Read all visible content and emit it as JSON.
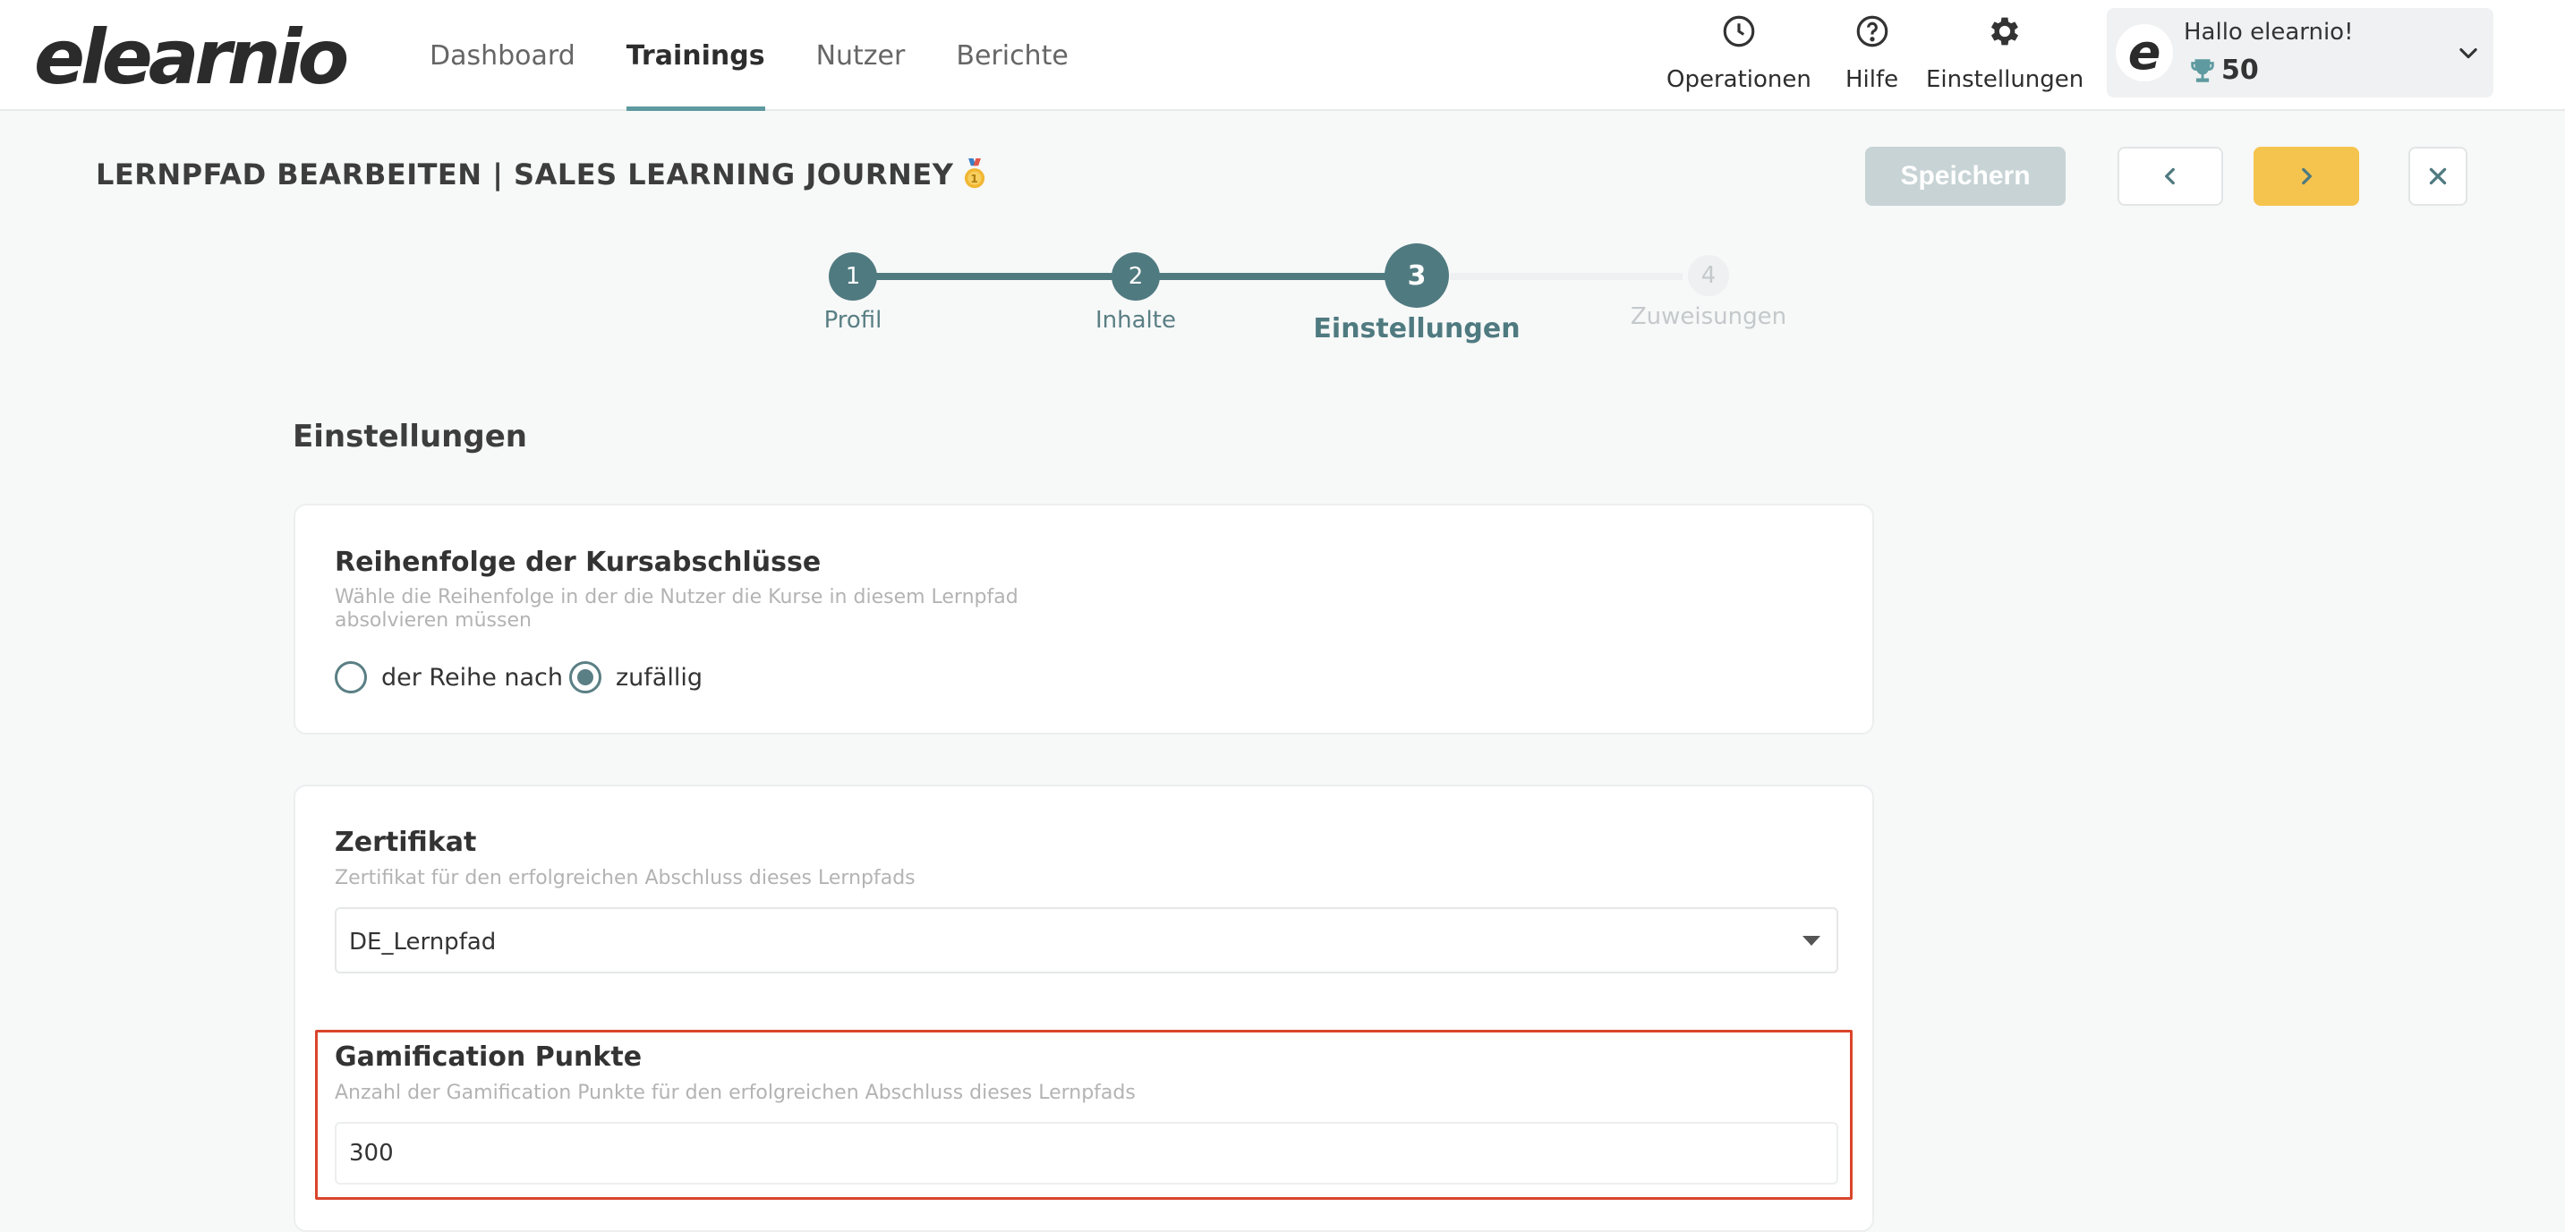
{
  "app": {
    "logo": "elearnio"
  },
  "nav": {
    "items": [
      {
        "label": "Dashboard",
        "active": false
      },
      {
        "label": "Trainings",
        "active": true
      },
      {
        "label": "Nutzer",
        "active": false
      },
      {
        "label": "Berichte",
        "active": false
      }
    ]
  },
  "tools": {
    "operations": {
      "label": "Operationen",
      "icon": "clock-icon"
    },
    "help": {
      "label": "Hilfe",
      "icon": "question-icon"
    },
    "settings": {
      "label": "Einstellungen",
      "icon": "gear-icon"
    }
  },
  "user": {
    "avatar_letter": "e",
    "greeting": "Hallo elearnio!",
    "points": "50",
    "icon": "trophy-icon"
  },
  "page": {
    "title": "LERNPFAD BEARBEITEN | SALES LEARNING JOURNEY",
    "save_label": "Speichern"
  },
  "stepper": {
    "steps": [
      {
        "number": "1",
        "label": "Profil",
        "state": "done"
      },
      {
        "number": "2",
        "label": "Inhalte",
        "state": "done"
      },
      {
        "number": "3",
        "label": "Einstellungen",
        "state": "current"
      },
      {
        "number": "4",
        "label": "Zuweisungen",
        "state": "todo"
      }
    ]
  },
  "settings": {
    "section_title": "Einstellungen",
    "order": {
      "title": "Reihenfolge der Kursabschlüsse",
      "description": "Wähle die Reihenfolge in der die Nutzer die Kurse in diesem Lernpfad absolvieren müssen",
      "options": [
        {
          "label": "der Reihe nach",
          "selected": false
        },
        {
          "label": "zufällig",
          "selected": true
        }
      ]
    },
    "certificate": {
      "title": "Zertifikat",
      "description": "Zertifikat für den erfolgreichen Abschluss dieses Lernpfads",
      "value": "DE_Lernpfad"
    },
    "gamification": {
      "title": "Gamification Punkte",
      "description": "Anzahl der Gamification Punkte für den erfolgreichen Abschluss dieses Lernpfads",
      "value": "300"
    }
  },
  "colors": {
    "accent": "#4f7a80",
    "accent_light": "#5e9aa0",
    "next_button": "#f5c44e",
    "save_disabled": "#c7d3d5",
    "highlight": "#d9452b"
  }
}
